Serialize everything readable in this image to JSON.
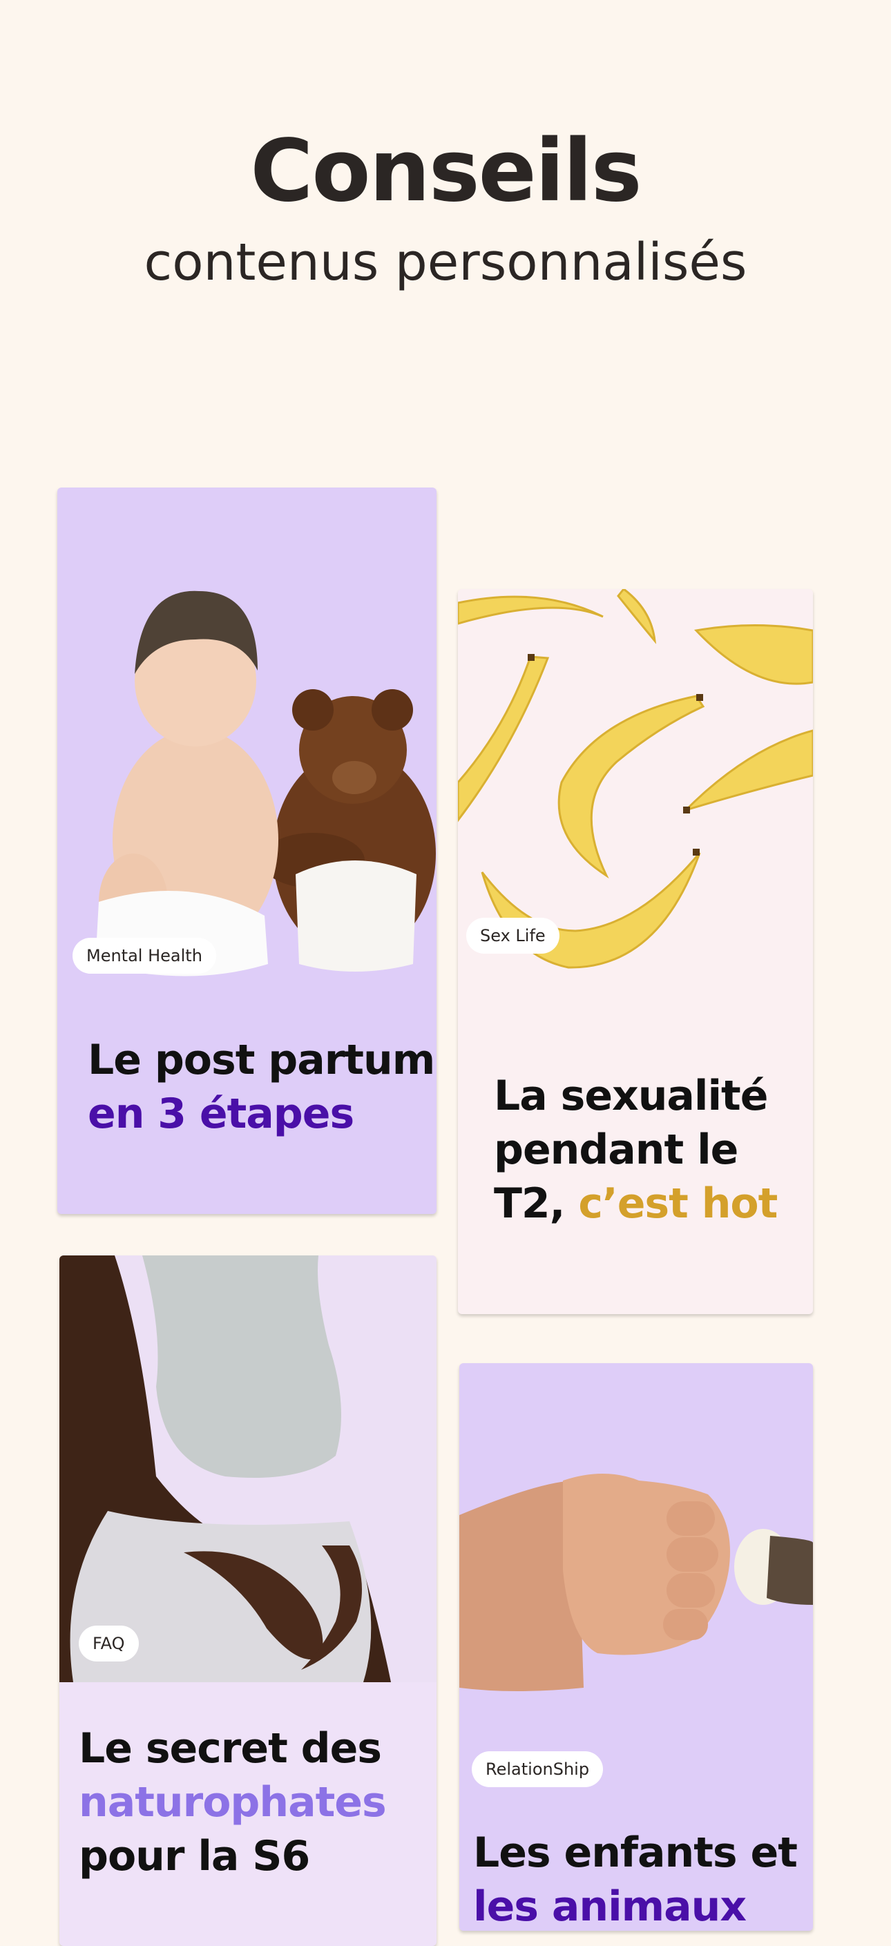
{
  "header": {
    "title": "Conseils",
    "subtitle": "contenus personnalisés"
  },
  "cards": [
    {
      "category": "Mental Health",
      "title_line1": "Le post partum",
      "title_line2": "en 3 étapes",
      "accent_color": "#4a0fa8",
      "background": "#decdf8",
      "image": "baby-with-teddy-bear"
    },
    {
      "category": "Sex Life",
      "title_line1": "La sexualité",
      "title_line2": "pendant le",
      "title_line3_prefix": "T2, ",
      "title_line3_accent": "c’est hot",
      "accent_color": "#d4a02b",
      "background": "#fbf0f2",
      "image": "bananas"
    },
    {
      "category": "FAQ",
      "title_line1": "Le secret des",
      "title_line2": "naturophates",
      "title_line3": "pour la S6",
      "accent_color": "#8c72e6",
      "background": "#efe2f8",
      "image": "pregnant-woman-torso"
    },
    {
      "category": "RelationShip",
      "title_line1": "Les enfants et",
      "title_line2": "les animaux",
      "accent_color": "#4a0fa8",
      "background": "#decdf8",
      "image": "fist-bump-with-paw"
    }
  ]
}
